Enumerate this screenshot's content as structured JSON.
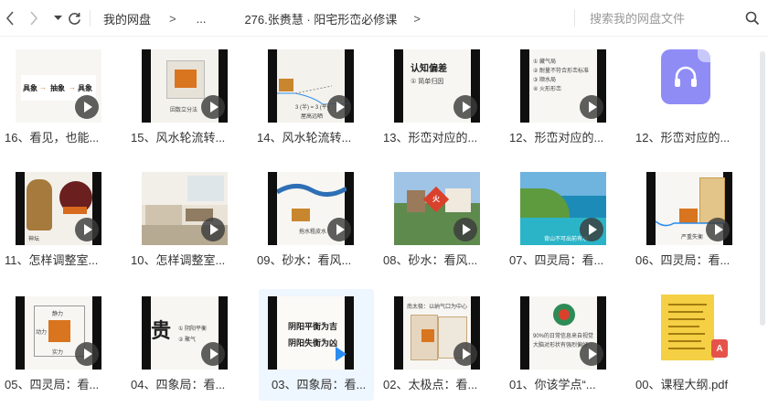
{
  "toolbar": {
    "back_icon": "back-icon",
    "forward_icon": "forward-icon",
    "dropdown_icon": "dropdown-icon",
    "refresh_icon": "refresh-icon"
  },
  "breadcrumb": {
    "root": "我的网盘",
    "sep": ">",
    "ellipsis": "...",
    "current": "276.张赉慧 · 阳宅形峦必修课",
    "end_sep": ">"
  },
  "search": {
    "placeholder": "搜索我的网盘文件"
  },
  "files": [
    {
      "label": "16、看见，也能...",
      "thumb": {
        "t1": "具象",
        "t2": "抽象",
        "t3": "具象"
      }
    },
    {
      "label": "15、风水轮流转...",
      "thumb": {
        "t1": "因数立分法"
      }
    },
    {
      "label": "14、风水轮流转...",
      "thumb": {
        "t1": "3 (半) = 3 (平)",
        "t2": "屋高远晒"
      }
    },
    {
      "label": "13、形峦对应的...",
      "thumb": {
        "t1": "认知偏差",
        "t2": "① 简单归因"
      }
    },
    {
      "label": "12、形峦对应的...",
      "thumb": {
        "l1": "① 藏气局",
        "l2": "② 耐量不符合形峦标准",
        "l3": "③ 顺水局",
        "l4": "④ 火形形峦"
      }
    },
    {
      "label": "12、形峦对应的...",
      "type": "audio"
    },
    {
      "label": "11、怎样调整室...",
      "thumb": {
        "t1": "神坛"
      }
    },
    {
      "label": "10、怎样调整室...",
      "thumb": {}
    },
    {
      "label": "09、砂水：看风...",
      "thumb": {
        "t1": "拖水粗皮水"
      }
    },
    {
      "label": "08、砂水：看风...",
      "thumb": {
        "t1": "火"
      }
    },
    {
      "label": "07、四灵局：看...",
      "thumb": {
        "t1": "背山不可出前有水"
      }
    },
    {
      "label": "06、四灵局：看...",
      "thumb": {
        "t1": "严重失衡"
      }
    },
    {
      "label": "05、四灵局：看...",
      "thumb": {
        "t1": "静力",
        "t2": "动力",
        "t3": "实力"
      }
    },
    {
      "label": "04、四象局：看...",
      "thumb": {
        "big": "贵",
        "l1": "① 阴阳平衡",
        "l2": "② 聚气"
      }
    },
    {
      "label": "03、四象局：看...",
      "selected": true,
      "thumb": {
        "l1": "阴阳平衡为吉",
        "l2": "阴阳失衡为凶"
      }
    },
    {
      "label": "02、太极点：看...",
      "thumb": {
        "t1": "南太极：以纳气口为中心"
      }
    },
    {
      "label": "01、你该学点“...",
      "thumb": {
        "l1": "90%的日常信息来自视觉",
        "l2": "大脑对形状有强烈偏好"
      }
    },
    {
      "label": "00、课程大纲.pdf",
      "type": "pdf",
      "pdf_badge": "A"
    }
  ]
}
